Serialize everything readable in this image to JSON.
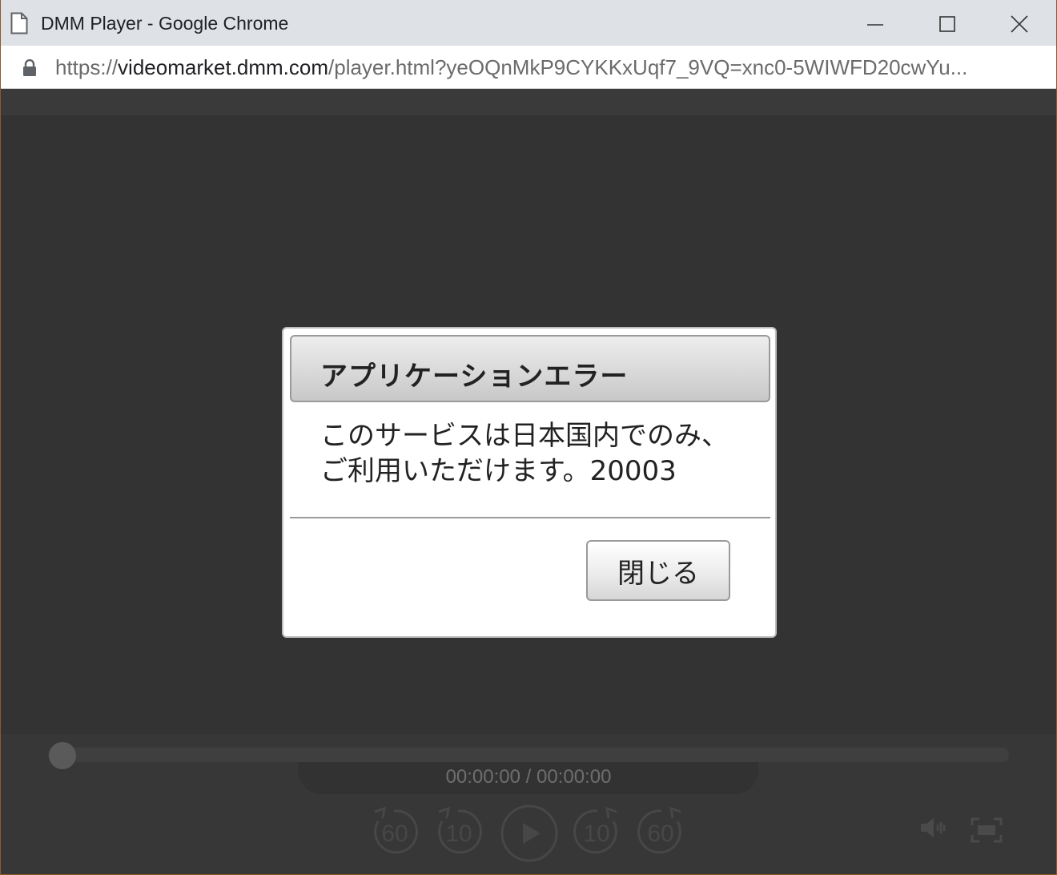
{
  "window": {
    "title": "DMM Player - Google Chrome"
  },
  "address_bar": {
    "scheme": "https://",
    "host": "videomarket.dmm.com",
    "path": "/player.html?yeOQnMkP9CYKKxUqf7_9VQ=xnc0-5WIWFD20cwYu..."
  },
  "dialog": {
    "title": "アプリケーションエラー",
    "message_line1": "このサービスは日本国内でのみ、",
    "message_line2": "ご利用いただけます。20003",
    "close_label": "閉じる"
  },
  "player": {
    "time": "00:00:00 / 00:00:00",
    "rewind_60_label": "60",
    "rewind_10_label": "10",
    "forward_10_label": "10",
    "forward_60_label": "60",
    "progress": 0
  },
  "colors": {
    "player_bg": "#333333",
    "controls_bg": "#373737",
    "dialog_bg": "#ffffff",
    "titlebar_bg": "#dee1e6"
  },
  "icons": [
    "page-icon",
    "minimize-icon",
    "maximize-icon",
    "close-icon",
    "lock-icon",
    "rewind-60-icon",
    "rewind-10-icon",
    "play-icon",
    "forward-10-icon",
    "forward-60-icon",
    "volume-icon",
    "fullscreen-icon"
  ]
}
